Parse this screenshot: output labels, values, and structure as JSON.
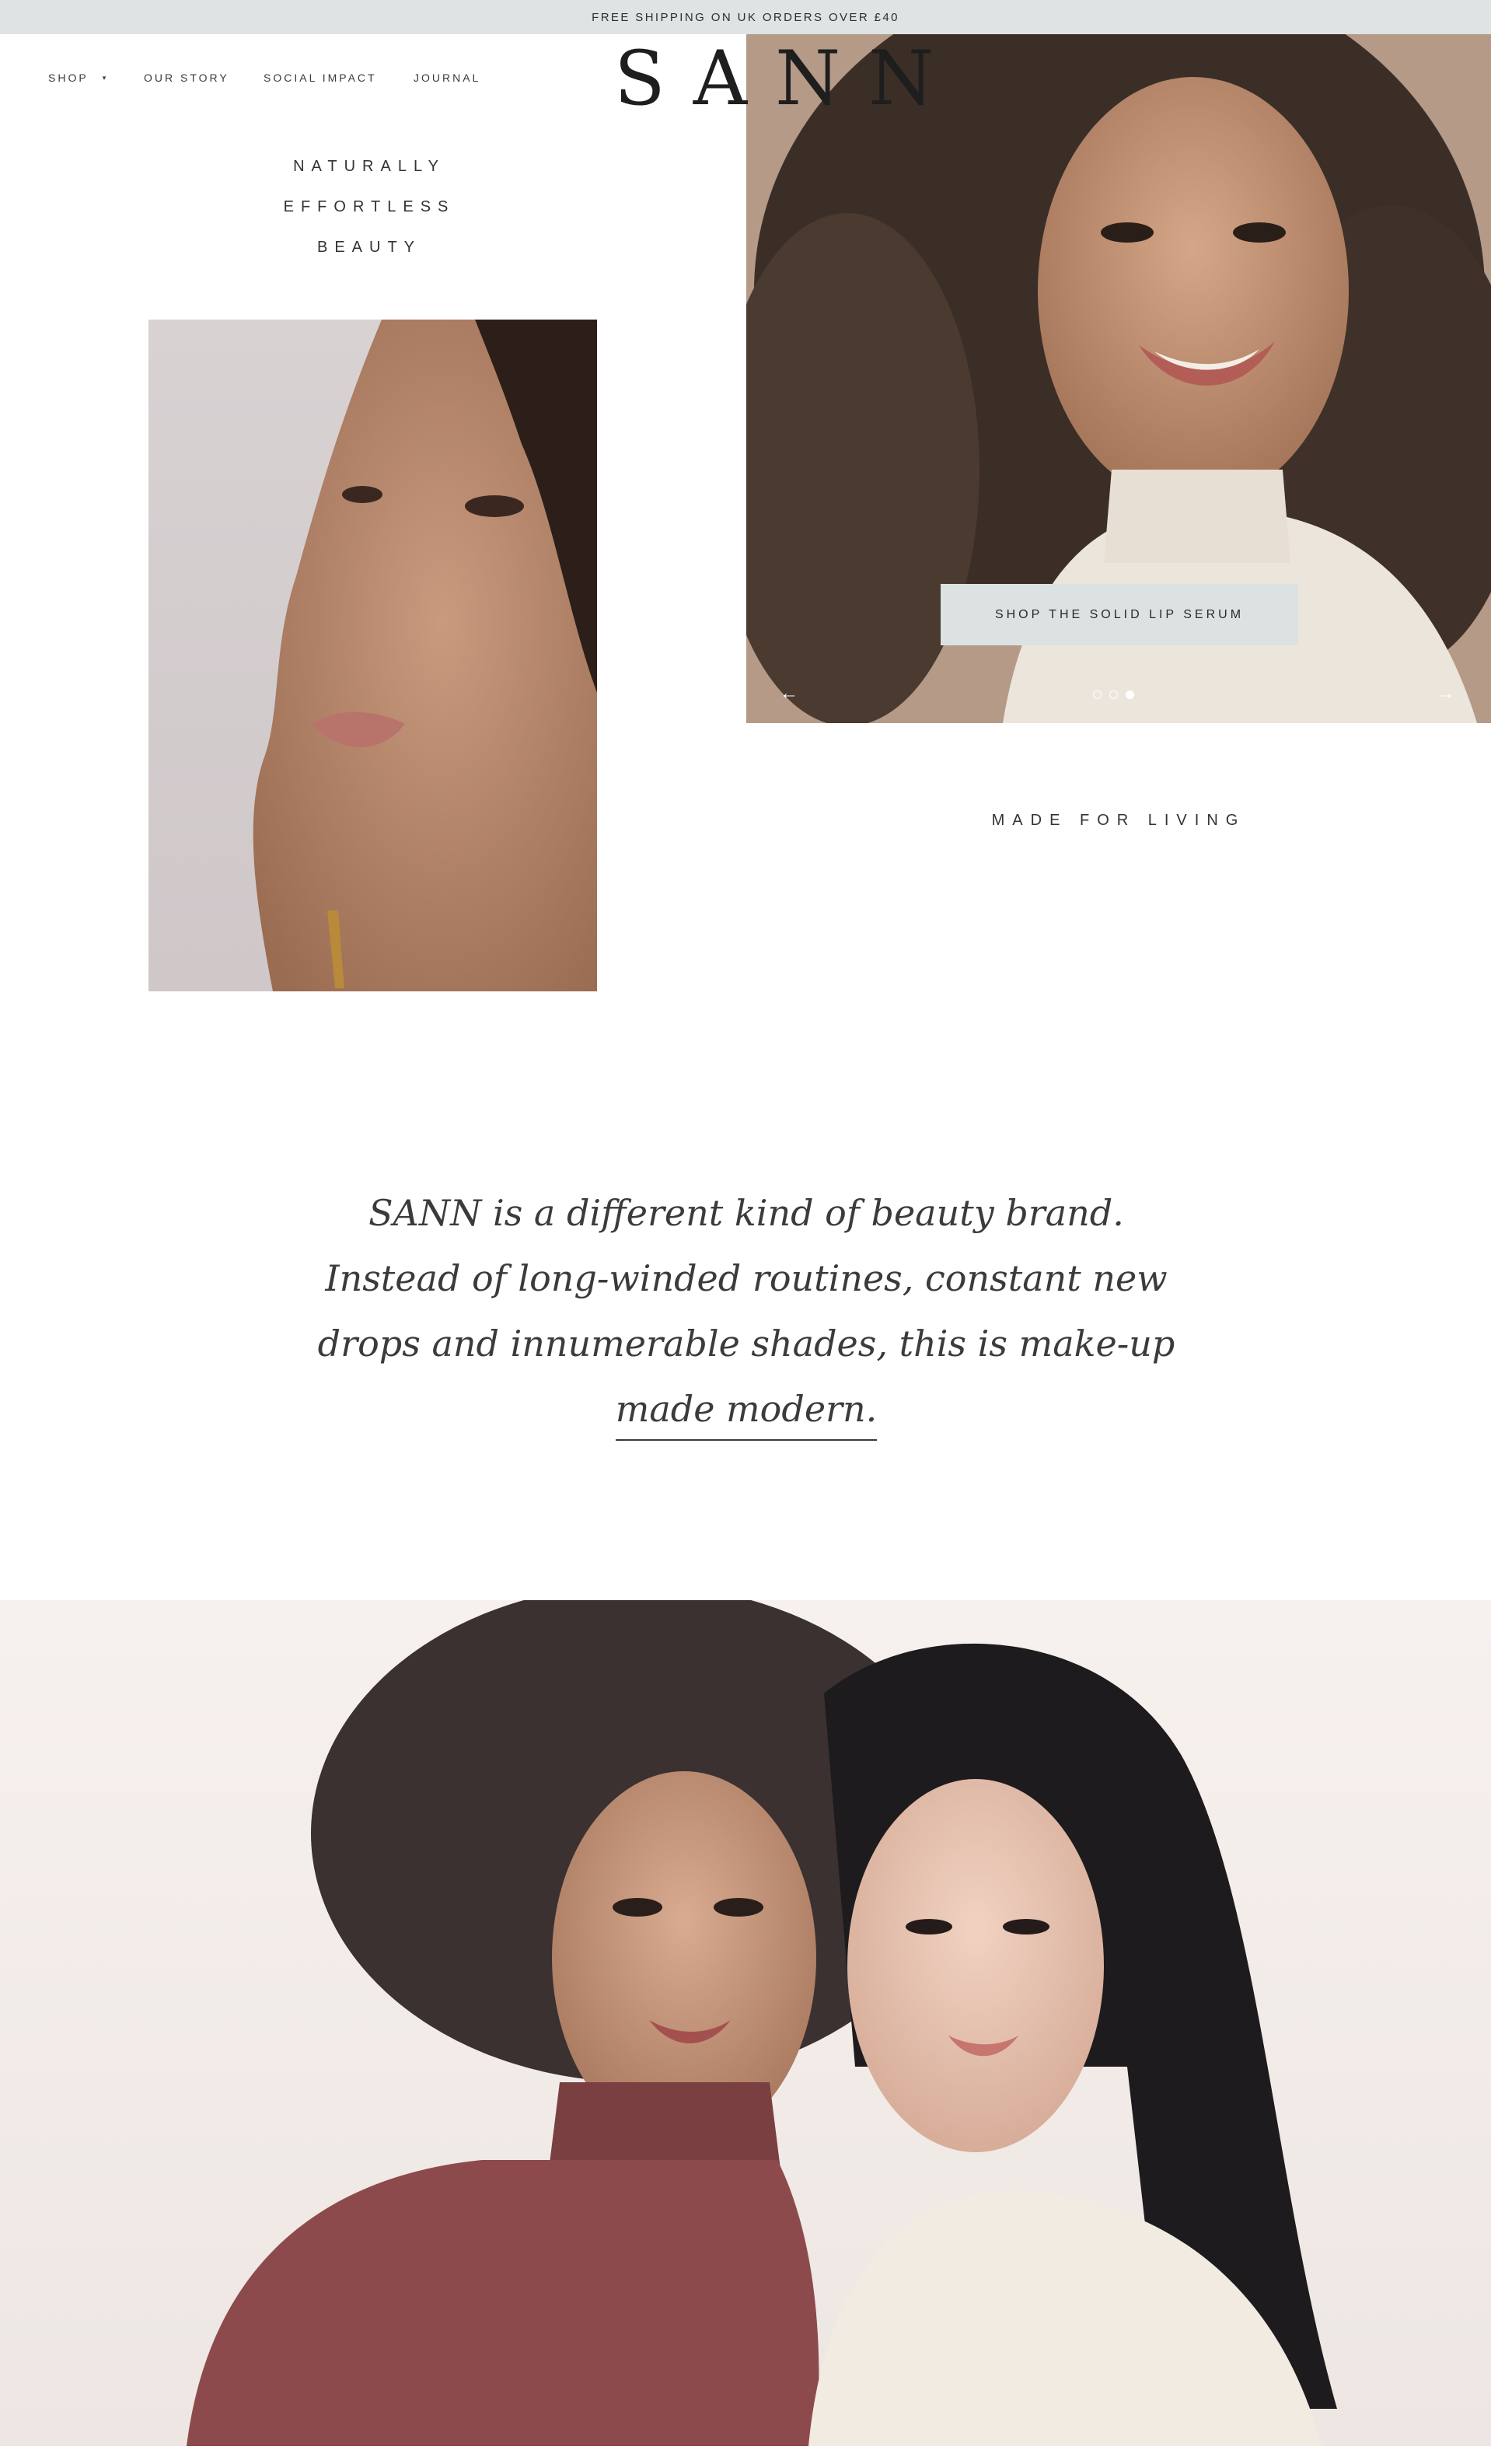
{
  "announcement": {
    "text": "FREE SHIPPING ON UK ORDERS OVER £40"
  },
  "nav": {
    "items": [
      {
        "label": "SHOP"
      },
      {
        "label": "OUR STORY"
      },
      {
        "label": "SOCIAL IMPACT"
      },
      {
        "label": "JOURNAL"
      }
    ],
    "shop_chevron": "▾"
  },
  "logo": {
    "text": "SANN"
  },
  "tagline": {
    "lines": [
      "NATURALLY",
      "EFFORTLESS",
      "BEAUTY"
    ]
  },
  "hero": {
    "cta_label": "SHOP THE SOLID LIP SERUM",
    "slides": 3,
    "active_slide": 3,
    "prev_arrow": "←",
    "next_arrow": "→"
  },
  "section": {
    "made_for_living": "MADE FOR LIVING"
  },
  "statement": {
    "text": "SANN is a different kind of beauty brand. Instead of long-winded routines, constant new drops and innumerable shades, this is make-up",
    "link_text": "made modern."
  },
  "colors": {
    "announcement_bg": "#dee3e3",
    "button_bg": "#dce2e2",
    "text": "#2b2b2b"
  }
}
